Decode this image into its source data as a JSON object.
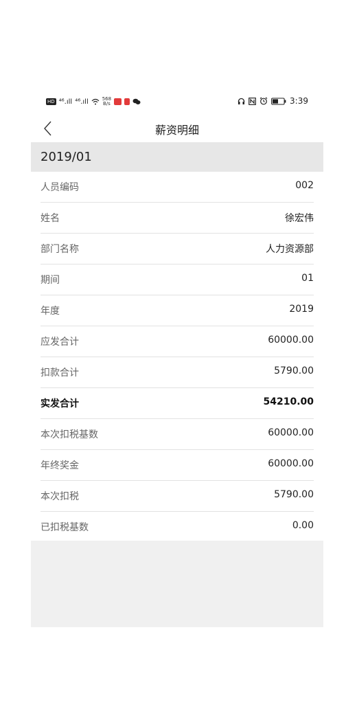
{
  "status_bar": {
    "hd": "HD",
    "sig1": "⁴⁶.ıll",
    "sig2": "⁴⁶.ıll",
    "speed_value": "568",
    "speed_unit": "B/s",
    "time": "3:39"
  },
  "header": {
    "title": "薪资明细"
  },
  "period": "2019/01",
  "rows": [
    {
      "label": "人员编码",
      "value": "002"
    },
    {
      "label": "姓名",
      "value": "徐宏伟"
    },
    {
      "label": "部门名称",
      "value": "人力资源部"
    },
    {
      "label": "期间",
      "value": "01"
    },
    {
      "label": "年度",
      "value": "2019"
    },
    {
      "label": "应发合计",
      "value": "60000.00"
    },
    {
      "label": "扣款合计",
      "value": "5790.00"
    },
    {
      "label": "实发合计",
      "value": "54210.00"
    },
    {
      "label": "本次扣税基数",
      "value": "60000.00"
    },
    {
      "label": "年终奖金",
      "value": "60000.00"
    },
    {
      "label": "本次扣税",
      "value": "5790.00"
    },
    {
      "label": "已扣税基数",
      "value": "0.00"
    }
  ]
}
